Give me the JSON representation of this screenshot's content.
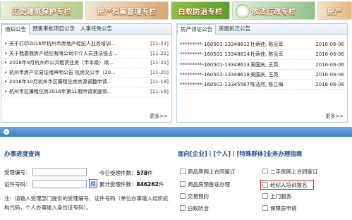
{
  "banners": [
    {
      "label": "历史建筑保护专栏"
    },
    {
      "label": "房产档案管理专栏"
    },
    {
      "label": "白蚁防治专栏"
    },
    {
      "label": "依法行政专栏"
    },
    {
      "label": "房产"
    }
  ],
  "left_panel": {
    "tabs": [
      "通知公告",
      "预售审批项目公示",
      "人事任免公告"
    ],
    "items": [
      {
        "title": "关于打印2016年杭州市房地产经纪人业务培训...",
        "date": "[11-23]"
      },
      {
        "title": "关于我委我房产经纪有限公司中介人员违法侵占...",
        "date": "[11-21]"
      },
      {
        "title": "2016年9月杭州市公共租赁住房（市本级）续...",
        "date": "[11-21]"
      },
      {
        "title": "杭州市房产交易证缮声明公告 杭房交公字（20...",
        "date": "[11-20]"
      },
      {
        "title": "2016年10月杭州市区廉租住房房源调整申请...",
        "date": "[11-19]"
      },
      {
        "title": "杭州市区廉租住房2016年第11期申请家庭领...",
        "date": "[11-19]"
      }
    ],
    "more": "更多>>"
  },
  "right_panel": {
    "tabs": [
      "房产领证公告",
      "房屋拆迁公告"
    ],
    "items": [
      {
        "cert": "*********-160501-13348812",
        "names": "杜萌佳, 陈见军",
        "date": "2016-06-06"
      },
      {
        "cert": "*********-160501-13348814",
        "names": "杜萌佳, 陈见军",
        "date": "2016-06-06"
      },
      {
        "cert": "*********-160501-13348613",
        "names": "吴国庆, 王英",
        "date": "2016-06-06"
      },
      {
        "cert": "*********-160501-13348618",
        "names": "吴国庆, 王英",
        "date": "2016-06-06"
      },
      {
        "cert": "*********-160501-13345567",
        "names": "陈洁然, 陈立梅",
        "date": "2016-06-06"
      }
    ],
    "more": "更多>>"
  },
  "query": {
    "title": "办事进度查询",
    "accept_label": "受理编号：",
    "cert_label": "证件号码：",
    "button_label": "搜",
    "today_label": "今日受理件数：",
    "today_count": "578",
    "today_unit": "件",
    "total_label": "累计受理件数：",
    "total_count": "846262",
    "total_unit": "件",
    "note": "注：请输入受理部门提供的受理编号、证件号码（单位办事输入组织机构代码，个人办事输入身份证号码）。"
  },
  "guide": {
    "title": "面向[企业]丨[个人]丨[特殊群体]业务办理指南",
    "items": [
      {
        "label": "商品房网上合同鉴订"
      },
      {
        "label": "二手房网上合同鉴订"
      },
      {
        "label": "商品房预售证办理"
      },
      {
        "label": "经纪人培训报名"
      },
      {
        "label": "交易预约"
      },
      {
        "label": "上门服务"
      },
      {
        "label": "白蚁防治"
      },
      {
        "label": "保障房申请"
      }
    ]
  },
  "colors": {
    "accent_blue": "#3f7fc4",
    "highlight_red": "#d9261c",
    "panel_border": "#b7cbe0"
  }
}
